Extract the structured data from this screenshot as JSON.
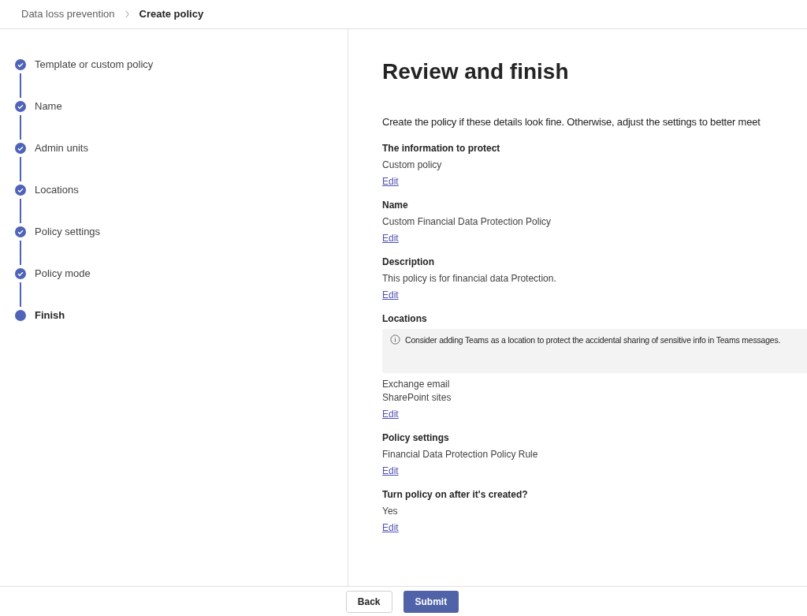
{
  "breadcrumb": [
    {
      "label": "Data loss prevention",
      "current": false
    },
    {
      "label": "Create policy",
      "current": true
    }
  ],
  "steps": [
    {
      "label": "Template or custom policy",
      "completed": true,
      "current": false
    },
    {
      "label": "Name",
      "completed": true,
      "current": false
    },
    {
      "label": "Admin units",
      "completed": true,
      "current": false
    },
    {
      "label": "Locations",
      "completed": true,
      "current": false
    },
    {
      "label": "Policy settings",
      "completed": true,
      "current": false
    },
    {
      "label": "Policy mode",
      "completed": true,
      "current": false
    },
    {
      "label": "Finish",
      "completed": false,
      "current": true
    }
  ],
  "title": "Review and finish",
  "intro": "Create the policy if these details look fine. Otherwise, adjust the settings to better meet",
  "sections": [
    {
      "heading": "The information to protect",
      "values": [
        "Custom policy"
      ],
      "link": "Edit"
    },
    {
      "heading": "Name",
      "values": [
        "Custom Financial Data Protection Policy"
      ],
      "link": "Edit"
    },
    {
      "heading": "Description",
      "values": [
        "This policy is for financial data Protection."
      ],
      "link": "Edit"
    },
    {
      "heading": "Locations",
      "notice": "Consider adding Teams as a location to protect the accidental sharing of sensitive info in Teams messages.",
      "values": [
        "Exchange email",
        "SharePoint sites"
      ],
      "link": "Edit"
    },
    {
      "heading": "Policy settings",
      "values": [
        "Financial Data Protection Policy Rule"
      ],
      "link": "Edit"
    },
    {
      "heading": "Turn policy on after it's created?",
      "values": [
        "Yes"
      ],
      "link": "Edit"
    }
  ],
  "buttons": [
    {
      "label": "Back",
      "kind": "secondary"
    },
    {
      "label": "Submit",
      "kind": "primary"
    }
  ]
}
